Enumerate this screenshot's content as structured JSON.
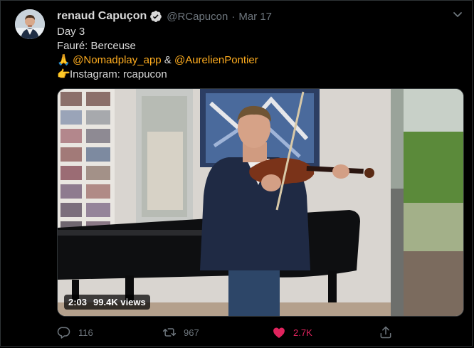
{
  "tweet": {
    "display_name": "renaud Capuçon",
    "handle": "@RCapucon",
    "separator": "·",
    "date": "Mar 17",
    "lines": {
      "l1": "Day 3",
      "l2": "Fauré: Berceuse",
      "l3_emoji": "🙏",
      "l3_mention1": "@Nomadplay_app",
      "l3_and": " & ",
      "l3_mention2": "@AurelienPontier",
      "l4_emoji": "👉",
      "l4_text": "Instagram: rcapucon"
    },
    "video": {
      "duration": "2:03",
      "views": "99.4K views"
    },
    "actions": {
      "replies": "116",
      "retweets": "967",
      "likes": "2.7K",
      "liked": true
    }
  },
  "colors": {
    "background": "#000000",
    "text": "#d9d9d9",
    "muted": "#6e767d",
    "mention": "#ffad1f",
    "like": "#e0245e",
    "verified": "#d9d9d9"
  },
  "icons": [
    "verified-badge-icon",
    "chevron-down-icon",
    "reply-icon",
    "retweet-icon",
    "heart-icon",
    "share-icon"
  ]
}
